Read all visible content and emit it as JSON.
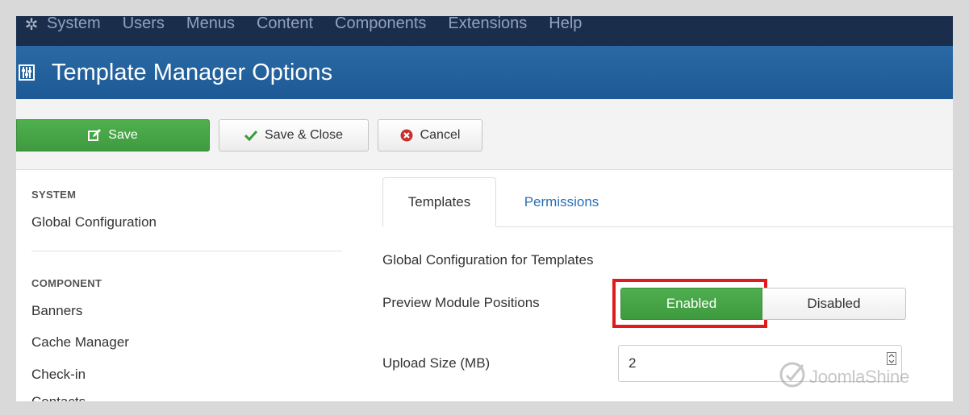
{
  "topnav": {
    "logo_icon": "joomla-icon",
    "items": [
      "System",
      "Users",
      "Menus",
      "Content",
      "Components",
      "Extensions",
      "Help"
    ]
  },
  "header": {
    "icon": "sliders-icon",
    "title": "Template Manager Options"
  },
  "toolbar": {
    "save_label": "Save",
    "save_close_label": "Save & Close",
    "cancel_label": "Cancel"
  },
  "sidebar": {
    "system_heading": "SYSTEM",
    "global_configuration": "Global Configuration",
    "component_heading": "COMPONENT",
    "items": [
      "Banners",
      "Cache Manager",
      "Check-in",
      "Contacts"
    ]
  },
  "main": {
    "tabs": [
      {
        "label": "Templates",
        "active": true
      },
      {
        "label": "Permissions",
        "active": false
      }
    ],
    "section_title": "Global Configuration for Templates",
    "preview_label": "Preview Module Positions",
    "enabled_label": "Enabled",
    "disabled_label": "Disabled",
    "upload_label": "Upload Size (MB)",
    "upload_value": "2"
  },
  "watermark": {
    "text": "JoomlaShine"
  },
  "colors": {
    "topnav_bg": "#1a2d4b",
    "header_bg": "#2a69a5",
    "save_green": "#46a546",
    "highlight_red": "#e01b1b",
    "link_blue": "#2a6fb5"
  }
}
